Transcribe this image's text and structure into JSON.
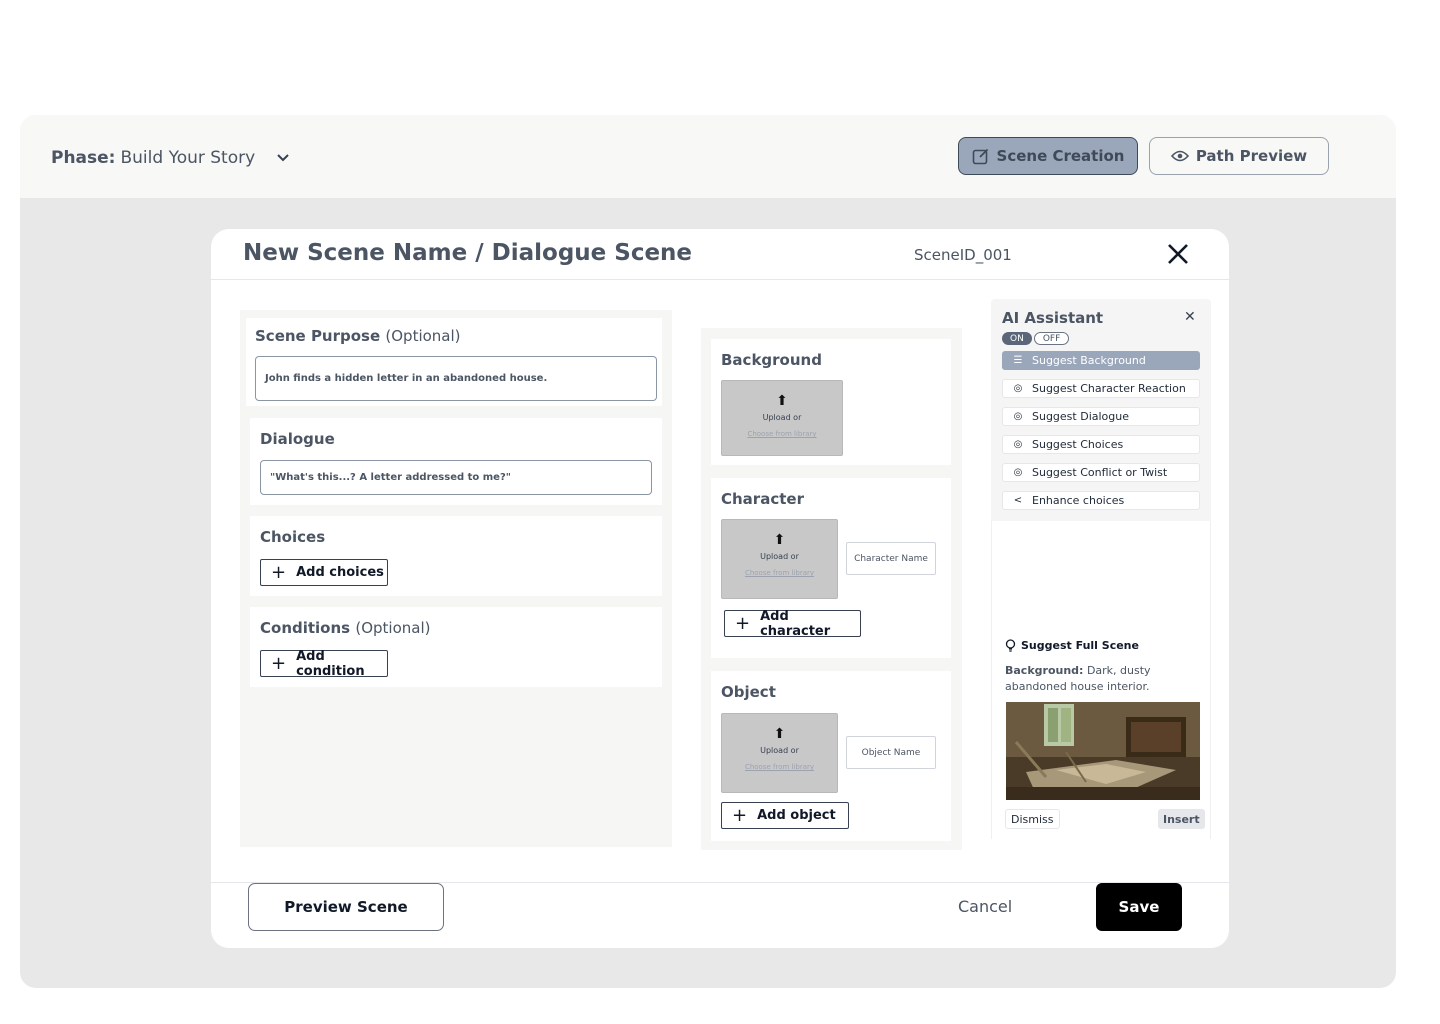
{
  "topbar": {
    "phase_label": "Phase:",
    "phase_value": "Build Your Story",
    "scene_creation": "Scene Creation",
    "path_preview": "Path Preview"
  },
  "modal": {
    "title": "New Scene Name / Dialogue Scene",
    "scene_id": "SceneID_001"
  },
  "scene_purpose": {
    "label": "Scene Purpose",
    "optional": "(Optional)",
    "value": "John finds a hidden letter in an abandoned house."
  },
  "dialogue": {
    "label": "Dialogue",
    "value": "\"What's this...? A letter addressed to me?\""
  },
  "choices": {
    "label": "Choices",
    "add": "Add choices"
  },
  "conditions": {
    "label": "Conditions",
    "optional": "(Optional)",
    "add": "Add condition"
  },
  "background": {
    "label": "Background",
    "upload": "Upload or",
    "library": "Choose from library"
  },
  "character": {
    "label": "Character",
    "upload": "Upload or",
    "library": "Choose from library",
    "name_placeholder": "Character Name",
    "add": "Add character"
  },
  "object": {
    "label": "Object",
    "upload": "Upload or",
    "library": "Choose from library",
    "name_placeholder": "Object Name",
    "add": "Add object"
  },
  "ai_assistant": {
    "title": "AI Assistant",
    "on": "ON",
    "off": "OFF",
    "items": [
      {
        "label": "Suggest Background",
        "icon": "list-icon"
      },
      {
        "label": "Suggest Character Reaction",
        "icon": "sparkle-icon"
      },
      {
        "label": "Suggest Dialogue",
        "icon": "sparkle-icon"
      },
      {
        "label": "Suggest Choices",
        "icon": "sparkle-icon"
      },
      {
        "label": "Suggest Conflict or Twist",
        "icon": "sparkle-icon"
      },
      {
        "label": "Enhance choices",
        "icon": "share-icon"
      }
    ],
    "suggest_full_scene": "Suggest Full Scene",
    "bg_label": "Background:",
    "bg_text": "Dark, dusty abandoned house interior.",
    "dismiss": "Dismiss",
    "insert": "Insert"
  },
  "footer": {
    "preview": "Preview Scene",
    "cancel": "Cancel",
    "save": "Save"
  }
}
